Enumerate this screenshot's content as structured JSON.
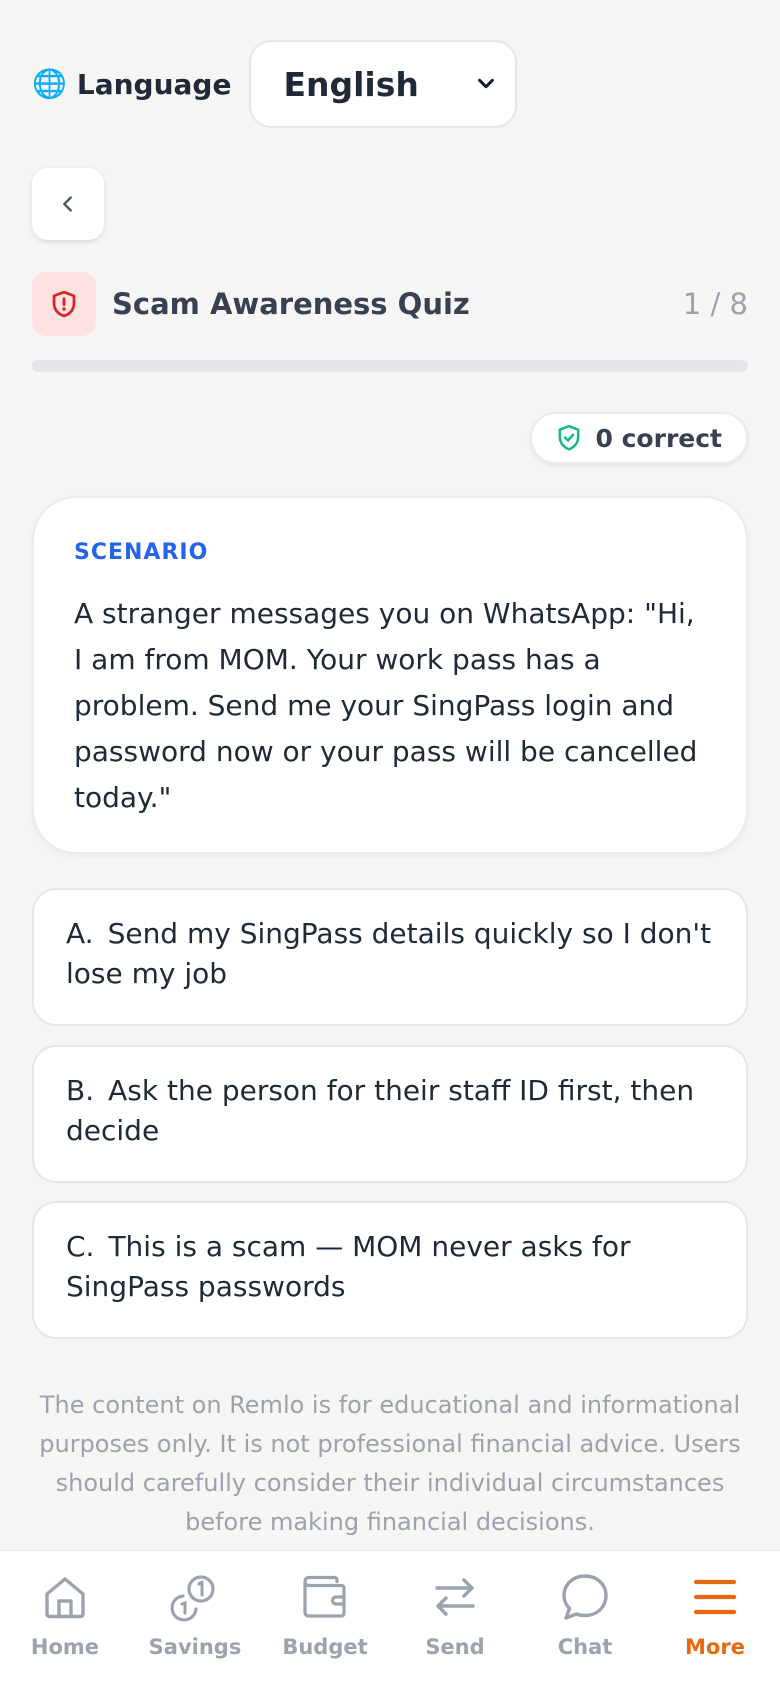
{
  "language": {
    "icon": "globe-icon",
    "label": "Language",
    "selected": "English"
  },
  "back": {
    "icon": "chevron-left-icon"
  },
  "quiz": {
    "icon": "shield-alert-icon",
    "title": "Scam Awareness Quiz",
    "progress_text": "1 / 8",
    "progress_fraction": 0,
    "correct_text": "0 correct",
    "correct_icon": "shield-check-icon"
  },
  "scenario": {
    "label": "SCENARIO",
    "text": "A stranger messages you on WhatsApp: \"Hi, I am from MOM. Your work pass has a problem. Send me your SingPass login and password now or your pass will be cancelled today.\""
  },
  "options": [
    {
      "letter": "A.",
      "text": "Send my SingPass details quickly so I don't lose my job"
    },
    {
      "letter": "B.",
      "text": "Ask the person for their staff ID first, then decide"
    },
    {
      "letter": "C.",
      "text": "This is a scam — MOM never asks for SingPass passwords"
    }
  ],
  "disclaimer": "The content on Remlo is for educational and informational purposes only. It is not professional financial advice. Users should carefully consider their individual circumstances before making financial decisions.",
  "nav": [
    {
      "label": "Home",
      "icon": "home-icon",
      "active": false
    },
    {
      "label": "Savings",
      "icon": "coins-icon",
      "active": false
    },
    {
      "label": "Budget",
      "icon": "wallet-icon",
      "active": false
    },
    {
      "label": "Send",
      "icon": "transfer-icon",
      "active": false
    },
    {
      "label": "Chat",
      "icon": "chat-bubble-icon",
      "active": false
    },
    {
      "label": "More",
      "icon": "menu-icon",
      "active": true
    }
  ],
  "colors": {
    "accent": "#e8680f",
    "scenario_label": "#2563eb",
    "shield_red": "#dc2626",
    "shield_bg": "#fde2e2",
    "correct_green": "#10b981",
    "inactive": "#9ca3af"
  }
}
